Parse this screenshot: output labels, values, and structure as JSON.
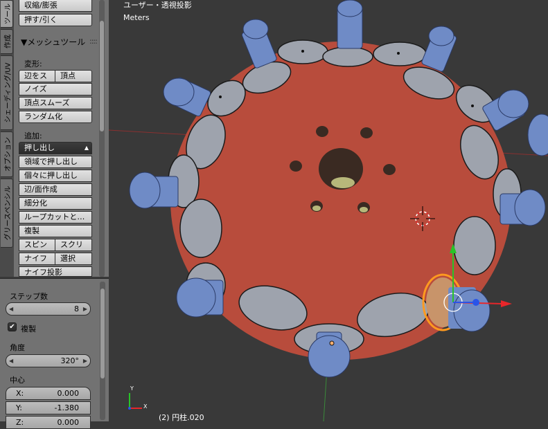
{
  "vertical_tabs": [
    {
      "label": "ツール",
      "active": true
    },
    {
      "label": "作成",
      "active": false
    },
    {
      "label": "シェーディング/UV",
      "active": false
    },
    {
      "label": "オプション",
      "active": false
    },
    {
      "label": "グリースペンシル",
      "active": false
    }
  ],
  "tool_shelf": {
    "top_buttons": [
      "収縮/膨張",
      "押す/引く"
    ],
    "mesh_tools_header": "▼メッシュツール",
    "deform_label": "変形:",
    "deform_row1": [
      "辺をス",
      "頂点"
    ],
    "deform_buttons": [
      "ノイズ",
      "頂点スムーズ",
      "ランダム化"
    ],
    "add_label": "追加:",
    "extrude_dropdown": "押し出し",
    "add_buttons": [
      "領域で押し出し",
      "個々に押し出し",
      "辺/面作成",
      "細分化",
      "ループカットと…",
      "複製"
    ],
    "add_row1": [
      "スピン",
      "スクリ"
    ],
    "add_row2": [
      "ナイフ",
      "選択"
    ],
    "knife_project": "ナイフ投影"
  },
  "operator_panel": {
    "steps_label": "ステップ数",
    "steps_value": "8",
    "dupli_label": "複製",
    "dupli_checked": true,
    "angle_label": "角度",
    "angle_value": "320°",
    "center_label": "中心",
    "center_x_label": "X:",
    "center_x": "0.000",
    "center_y_label": "Y:",
    "center_y": "-1.380",
    "center_z_label": "Z:",
    "center_z": "0.000"
  },
  "viewport": {
    "view_name": "ユーザー・透視投影",
    "units": "Meters",
    "object_info": "(2) 円柱.020",
    "axis_x": "X",
    "axis_y": "Y",
    "colors": {
      "background": "#393939",
      "disc": "#b84c3c",
      "wheel": "#9ea3ad",
      "roller": "#6f8bc6",
      "selection": "#ff9a1f",
      "gizmo_red": "#e8262a",
      "gizmo_green": "#28c428",
      "gizmo_blue": "#2a54e8"
    }
  }
}
